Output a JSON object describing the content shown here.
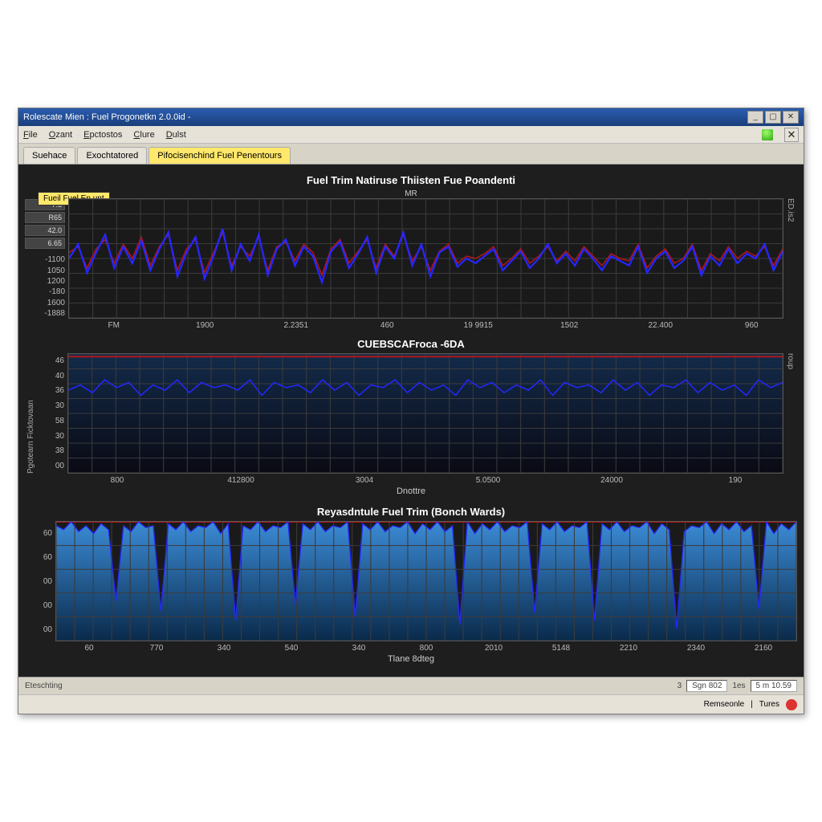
{
  "window": {
    "title": "Rolescate Mien : Fuel Progonetkn 2.0.0id -"
  },
  "menu": {
    "items": [
      "File",
      "Ozant",
      "Epctostos",
      "Clure",
      "Dulst"
    ]
  },
  "tabs": {
    "items": [
      "Suehace",
      "Exochtatored",
      "Pifocisenchind Fuel Penentours"
    ],
    "active": 2
  },
  "statusbar": {
    "left": "Eteschting",
    "field1_label": "3",
    "field1_value": "Sgn 802",
    "field2_label": "1es",
    "field2_value": "5 m 10.59"
  },
  "footer": {
    "btn1": "Remseonle",
    "btn2": "Tures"
  },
  "panel1": {
    "title": "Fuel Trim Natiruse Thiisten Fue Poandenti",
    "subtitle": "MR",
    "badge": "Fueil Fuel En.unt",
    "ylabel_right": "ED.is2",
    "legend": [
      "7.5",
      "R65",
      "42.0",
      "6.65"
    ],
    "y_ticks": [
      "-1100",
      "1050",
      "1200",
      "-180",
      "1600",
      "-1888"
    ],
    "x_ticks": [
      "FM",
      "1900",
      "2.2351",
      "460",
      "19 9915",
      "1502",
      "22.400",
      "960"
    ]
  },
  "panel2": {
    "title": "CUEBSCAFroca -6DA",
    "ylabel_left": "Pgotearn Ficktovaan",
    "ylabel_right": "roup",
    "y_ticks": [
      "46",
      "40",
      "36",
      "30",
      "58",
      "30",
      "38",
      "00"
    ],
    "x_ticks": [
      "800",
      "412800",
      "3004",
      "5.0500",
      "24000",
      "190"
    ],
    "x_sublabel": "Dnottre"
  },
  "panel3": {
    "title": "Reyasdntule Fuel Trim (Bonch Wards)",
    "y_ticks": [
      "60",
      "60",
      "00",
      "00",
      "00"
    ],
    "x_ticks": [
      "60",
      "770",
      "340",
      "540",
      "340",
      "800",
      "2010",
      "5148",
      "2210",
      "2340",
      "2160"
    ],
    "x_sublabel": "Tlane 8dteg"
  },
  "colors": {
    "series1": "#2626ff",
    "series2": "#b01818",
    "grid": "#3b3b3b",
    "bg": "#1a1a1a",
    "fill": "#1a5fb4"
  },
  "chart_data": [
    {
      "type": "line",
      "title": "Fuel Trim Natiruse Thiisten Fue Poandenti",
      "xlabel": "",
      "ylabel": "",
      "x": [
        0,
        1,
        2,
        3,
        4,
        5,
        6,
        7,
        8,
        9,
        10,
        11,
        12,
        13,
        14,
        15,
        16,
        17,
        18,
        19,
        20,
        21,
        22,
        23,
        24,
        25,
        26,
        27,
        28,
        29,
        30,
        31,
        32,
        33,
        34,
        35,
        36,
        37,
        38,
        39,
        40,
        41,
        42,
        43,
        44,
        45,
        46,
        47,
        48,
        49,
        50,
        51,
        52,
        53,
        54,
        55,
        56,
        57,
        58,
        59,
        60,
        61,
        62,
        63,
        64,
        65,
        66,
        67,
        68,
        69,
        70,
        71,
        72,
        73,
        74,
        75,
        76,
        77,
        78,
        79
      ],
      "series": [
        {
          "name": "blue",
          "values": [
            50,
            62,
            38,
            55,
            70,
            42,
            60,
            46,
            65,
            40,
            58,
            72,
            35,
            55,
            68,
            33,
            52,
            75,
            40,
            62,
            48,
            70,
            36,
            58,
            66,
            44,
            60,
            52,
            30,
            56,
            64,
            42,
            54,
            68,
            38,
            60,
            50,
            72,
            44,
            62,
            35,
            55,
            60,
            43,
            50,
            46,
            52,
            58,
            40,
            48,
            56,
            42,
            50,
            62,
            46,
            54,
            44,
            58,
            50,
            40,
            52,
            48,
            44,
            60,
            38,
            50,
            56,
            42,
            48,
            60,
            36,
            52,
            44,
            58,
            46,
            54,
            50,
            62,
            40,
            56
          ]
        },
        {
          "name": "red",
          "values": [
            55,
            60,
            42,
            58,
            66,
            46,
            62,
            50,
            68,
            44,
            60,
            70,
            40,
            58,
            66,
            38,
            55,
            72,
            44,
            60,
            52,
            68,
            40,
            60,
            64,
            48,
            62,
            55,
            36,
            58,
            66,
            46,
            56,
            66,
            42,
            62,
            52,
            70,
            48,
            60,
            40,
            56,
            62,
            46,
            52,
            50,
            54,
            60,
            44,
            50,
            58,
            46,
            52,
            60,
            48,
            56,
            48,
            60,
            52,
            44,
            54,
            50,
            48,
            62,
            42,
            52,
            58,
            46,
            50,
            62,
            40,
            54,
            48,
            60,
            50,
            56,
            52,
            60,
            44,
            58
          ]
        }
      ],
      "ylim": [
        0,
        100
      ]
    },
    {
      "type": "line",
      "title": "CUEBSCAFroca -6DA",
      "xlabel": "Dnottre",
      "ylabel": "Pgotearn Ficktovaan",
      "x": [
        0,
        1,
        2,
        3,
        4,
        5,
        6,
        7,
        8,
        9,
        10,
        11,
        12,
        13,
        14,
        15,
        16,
        17,
        18,
        19,
        20,
        21,
        22,
        23,
        24,
        25,
        26,
        27,
        28,
        29,
        30,
        31,
        32,
        33,
        34,
        35,
        36,
        37,
        38,
        39,
        40,
        41,
        42,
        43,
        44,
        45,
        46,
        47,
        48,
        49,
        50,
        51,
        52,
        53,
        54,
        55,
        56,
        57,
        58,
        59
      ],
      "series": [
        {
          "name": "blue",
          "values": [
            32,
            34,
            31,
            36,
            33,
            35,
            30,
            34,
            32,
            36,
            31,
            35,
            33,
            34,
            32,
            36,
            30,
            35,
            33,
            34,
            31,
            36,
            32,
            35,
            30,
            34,
            33,
            36,
            31,
            35,
            32,
            34,
            30,
            36,
            33,
            35,
            31,
            34,
            32,
            36,
            30,
            35,
            33,
            34,
            31,
            36,
            32,
            35,
            30,
            34,
            33,
            36,
            31,
            35,
            32,
            34,
            30,
            36,
            33,
            35
          ]
        },
        {
          "name": "red_top",
          "values": [
            45,
            45,
            45,
            45,
            45,
            45,
            45,
            45,
            45,
            45,
            45,
            45,
            45,
            45,
            45,
            45,
            45,
            45,
            45,
            45,
            45,
            45,
            45,
            45,
            45,
            45,
            45,
            45,
            45,
            45,
            45,
            45,
            45,
            45,
            45,
            45,
            45,
            45,
            45,
            45,
            45,
            45,
            45,
            45,
            45,
            45,
            45,
            45,
            45,
            45,
            45,
            45,
            45,
            45,
            45,
            45,
            45,
            45,
            45,
            45
          ]
        }
      ],
      "ylim": [
        0,
        46
      ]
    },
    {
      "type": "area",
      "title": "Reyasdntule Fuel Trim (Bonch Wards)",
      "xlabel": "Tlane 8dteg",
      "ylabel": "",
      "x": [
        0,
        1,
        2,
        3,
        4,
        5,
        6,
        7,
        8,
        9,
        10,
        11,
        12,
        13,
        14,
        15,
        16,
        17,
        18,
        19,
        20,
        21,
        22,
        23,
        24,
        25,
        26,
        27,
        28,
        29,
        30,
        31,
        32,
        33,
        34,
        35,
        36,
        37,
        38,
        39,
        40,
        41,
        42,
        43,
        44,
        45,
        46,
        47,
        48,
        49,
        50,
        51,
        52,
        53,
        54,
        55,
        56,
        57,
        58,
        59,
        60,
        61,
        62,
        63,
        64,
        65,
        66,
        67,
        68,
        69,
        70,
        71,
        72,
        73,
        74,
        75,
        76,
        77,
        78,
        79,
        80,
        81,
        82,
        83,
        84,
        85,
        86,
        87,
        88,
        89,
        90,
        91,
        92,
        93,
        94,
        95,
        96,
        97,
        98,
        99
      ],
      "series": [
        {
          "name": "fill",
          "values": [
            58,
            56,
            60,
            55,
            58,
            54,
            59,
            56,
            20,
            58,
            55,
            60,
            57,
            58,
            15,
            59,
            56,
            60,
            55,
            58,
            57,
            60,
            54,
            59,
            10,
            58,
            56,
            60,
            55,
            58,
            57,
            60,
            18,
            59,
            56,
            60,
            55,
            58,
            57,
            60,
            12,
            59,
            56,
            60,
            55,
            58,
            57,
            60,
            54,
            59,
            56,
            60,
            55,
            58,
            8,
            60,
            54,
            59,
            56,
            60,
            55,
            58,
            57,
            60,
            14,
            59,
            56,
            60,
            55,
            58,
            57,
            60,
            10,
            59,
            56,
            60,
            55,
            58,
            57,
            60,
            54,
            59,
            56,
            6,
            55,
            58,
            57,
            60,
            54,
            59,
            56,
            60,
            55,
            58,
            16,
            60,
            54,
            59,
            56,
            60
          ]
        },
        {
          "name": "red_top",
          "values": [
            60,
            60,
            60,
            60,
            60,
            60,
            60,
            60,
            60,
            60,
            60,
            60,
            60,
            60,
            60,
            60,
            60,
            60,
            60,
            60,
            60,
            60,
            60,
            60,
            60,
            60,
            60,
            60,
            60,
            60,
            60,
            60,
            60,
            60,
            60,
            60,
            60,
            60,
            60,
            60,
            60,
            60,
            60,
            60,
            60,
            60,
            60,
            60,
            60,
            60,
            60,
            60,
            60,
            60,
            60,
            60,
            60,
            60,
            60,
            60,
            60,
            60,
            60,
            60,
            60,
            60,
            60,
            60,
            60,
            60,
            60,
            60,
            60,
            60,
            60,
            60,
            60,
            60,
            60,
            60,
            60,
            60,
            60,
            60,
            60,
            60,
            60,
            60,
            60,
            60,
            60,
            60,
            60,
            60,
            60,
            60,
            60,
            60,
            60,
            60
          ]
        }
      ],
      "ylim": [
        0,
        60
      ]
    }
  ]
}
